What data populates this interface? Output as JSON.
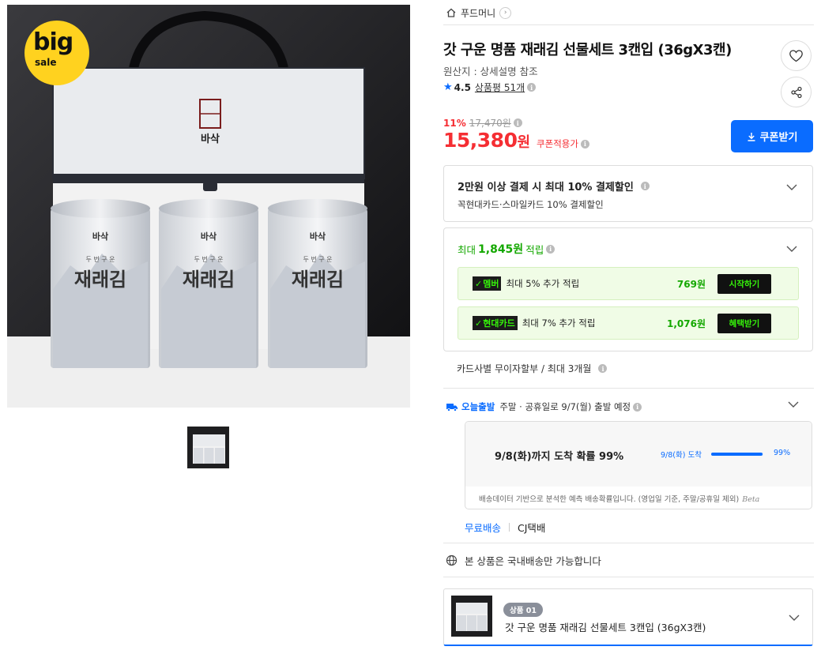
{
  "breadcrumb": {
    "home_icon": "home-icon",
    "label": "푸드머니"
  },
  "product": {
    "title": "갓 구운 명품 재래김 선물세트 3캔입 (36gX3캔)",
    "origin": "원산지 : 상세설명 참조",
    "rating": "4.5",
    "reviews": "상품평 51개",
    "discount_pct": "11%",
    "original_price": "17,470원",
    "price": "15,380",
    "price_unit": "원",
    "coupon_note": "쿠폰적용가",
    "coupon_button": "쿠폰받기"
  },
  "image": {
    "badge_big": "big",
    "badge_sale": "sale",
    "box_brand": "바삭",
    "can_brand": "바삭",
    "can_name": "재래김",
    "can_sub": "두 번 구 운"
  },
  "payment_discount": {
    "title": "2만원 이상 결제 시 최대 10% 결제할인",
    "subtitle": "꼭현대카드·스마일카드 10% 결제할인"
  },
  "points": {
    "prefix": "최대",
    "amount": "1,845원",
    "suffix": "적립",
    "rows": [
      {
        "tag": "멤버",
        "label": "최대 5% 추가 적립",
        "amount": "769원",
        "button": "시작하기"
      },
      {
        "tag": "현대카드",
        "label": "최대 7% 추가 적립",
        "amount": "1,076원",
        "button": "혜택받기"
      }
    ]
  },
  "installment": "카드사별 무이자할부 / 최대 3개월",
  "delivery": {
    "badge": "오늘출발",
    "text": "주말 · 공휴일로 9/7(월) 출발 예정",
    "prob_title": "9/8(화)까지 도착 확률 99%",
    "prob_date": "9/8(화) 도착",
    "prob_pct": "99%",
    "prob_fill": 0.99,
    "note": "배송데이터 기반으로 분석한 예측 배송확률입니다. (영업일 기준, 주말/공휴일 제외)",
    "note_mark": "Beta",
    "shipping_fee": "무료배송",
    "carrier": "CJ택배"
  },
  "domestic": "본 상품은 국내배송만 가능합니다",
  "option": {
    "badge": "상품 01",
    "name": "갓 구운 명품 재래김 선물세트 3캔입 (36gX3캔)"
  },
  "colors": {
    "accent_blue": "#0a6cff",
    "price_red": "#f52e33",
    "points_green": "#14a800",
    "badge_yellow": "#ffd21f"
  }
}
